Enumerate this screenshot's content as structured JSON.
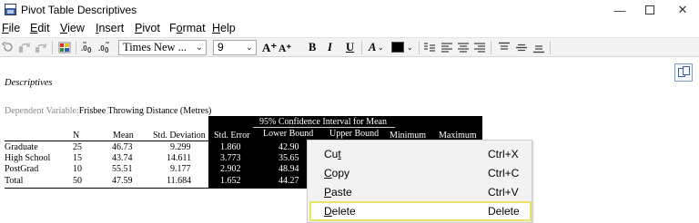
{
  "window": {
    "title": "Pivot Table Descriptives",
    "minimize_glyph": "—",
    "close_glyph": "✕"
  },
  "menu": [
    {
      "key": "F",
      "rest": "ile"
    },
    {
      "key": "E",
      "rest": "dit"
    },
    {
      "key": "V",
      "rest": "iew"
    },
    {
      "key": "I",
      "rest": "nsert"
    },
    {
      "key": "P",
      "rest": "ivot"
    },
    {
      "pre": "F",
      "key": "o",
      "rest": "rmat"
    },
    {
      "key": "H",
      "rest": "elp"
    }
  ],
  "toolbar": {
    "font_name": "Times New ...",
    "font_size": "9",
    "dropdown_arrow": "⌄",
    "grow_font": "A⁺",
    "shrink_font": "A⁺",
    "bold": "B",
    "italic": "I",
    "underline": "U",
    "text_color_letter": "A",
    "fill_color": "#000000"
  },
  "output": {
    "title": "Descriptives",
    "dependent_label": "Dependent Variable:",
    "dependent_value": "Frisbee Throwing Distance (Metres)",
    "ci_header": "95% Confidence Interval for Mean",
    "columns": {
      "n": "N",
      "mean": "Mean",
      "std_dev": "Std. Deviation",
      "std_err": "Std. Error",
      "lower": "Lower Bound",
      "upper": "Upper Bound",
      "min": "Minimum",
      "max": "Maximum"
    },
    "rows": [
      {
        "label": "Graduate",
        "n": "25",
        "mean": "46.73",
        "sd": "9.299",
        "se": "1.860",
        "lower": "42.90"
      },
      {
        "label": "High School",
        "n": "15",
        "mean": "43.74",
        "sd": "14.611",
        "se": "3.773",
        "lower": "35.65"
      },
      {
        "label": "PostGrad",
        "n": "10",
        "mean": "55.51",
        "sd": "9.177",
        "se": "2.902",
        "lower": "48.94"
      },
      {
        "label": "Total",
        "n": "50",
        "mean": "47.59",
        "sd": "11.684",
        "se": "1.652",
        "lower": "44.27"
      }
    ]
  },
  "context_menu": [
    {
      "pre": "Cu",
      "key": "t",
      "rest": "",
      "shortcut": "Ctrl+X"
    },
    {
      "pre": "",
      "key": "C",
      "rest": "opy",
      "shortcut": "Ctrl+C"
    },
    {
      "pre": "",
      "key": "P",
      "rest": "aste",
      "shortcut": "Ctrl+V"
    },
    {
      "pre": "",
      "key": "D",
      "rest": "elete",
      "shortcut": "Delete",
      "highlighted": true
    }
  ],
  "colors": {
    "highlight_border": "#e8e36a",
    "table_fill": "#000000",
    "menu_bg": "#f2f2f2"
  }
}
